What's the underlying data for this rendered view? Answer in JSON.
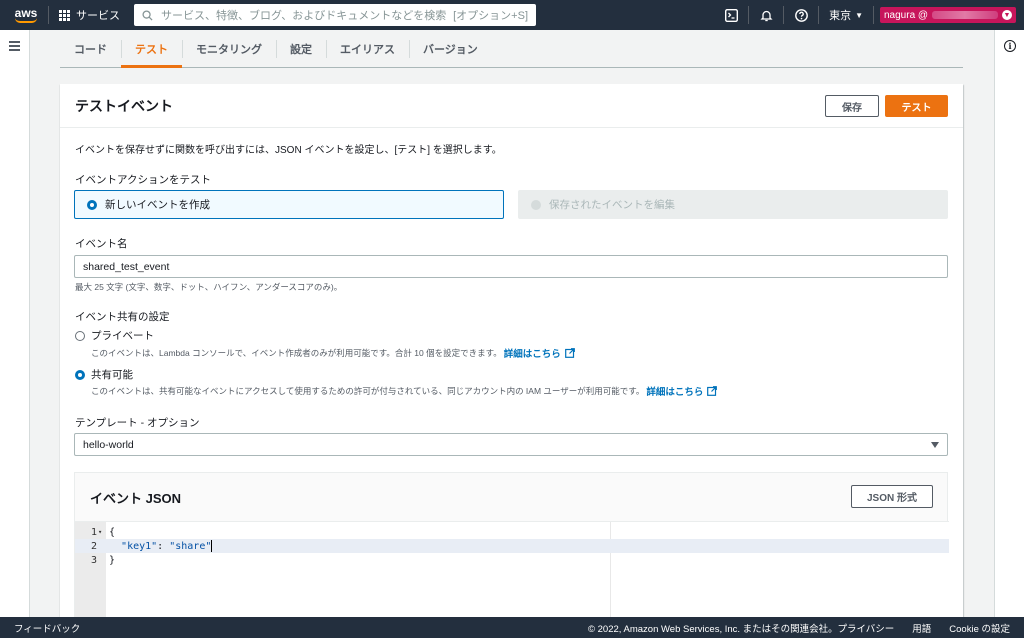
{
  "topnav": {
    "logo_text": "aws",
    "services_label": "サービス",
    "search_placeholder": "サービス、特徴、ブログ、およびドキュメントなどを検索",
    "search_shortcut": "[オプション+S]",
    "region_label": "東京",
    "account_label": "nagura @"
  },
  "tabs": [
    {
      "label": "コード",
      "active": false
    },
    {
      "label": "テスト",
      "active": true
    },
    {
      "label": "モニタリング",
      "active": false
    },
    {
      "label": "設定",
      "active": false
    },
    {
      "label": "エイリアス",
      "active": false
    },
    {
      "label": "バージョン",
      "active": false
    }
  ],
  "panel": {
    "title": "テストイベント",
    "save_label": "保存",
    "test_label": "テスト",
    "description": "イベントを保存せずに関数を呼び出すには、JSON イベントを設定し、[テスト] を選択します。",
    "action_label": "イベントアクションをテスト",
    "action_new": "新しいイベントを作成",
    "action_edit_saved": "保存されたイベントを編集",
    "event_name_label": "イベント名",
    "event_name_value": "shared_test_event",
    "event_name_hint": "最大 25 文字 (文字、数字、ドット、ハイフン、アンダースコアのみ)。",
    "sharing_label": "イベント共有の設定",
    "private_label": "プライベート",
    "private_desc": "このイベントは、Lambda コンソールで、イベント作成者のみが利用可能です。合計 10 個を設定できます。",
    "shareable_label": "共有可能",
    "shareable_desc": "このイベントは、共有可能なイベントにアクセスして使用するための許可が付与されている、同じアカウント内の IAM ユーザーが利用可能です。",
    "learn_more": "詳細はこちら",
    "template_label": "テンプレート - オプション",
    "template_value": "hello-world"
  },
  "json_editor": {
    "title": "イベント JSON",
    "format_button": "JSON 形式",
    "lines": [
      {
        "num": "1",
        "text": "{"
      },
      {
        "num": "2",
        "key": "\"key1\"",
        "sep": ": ",
        "value": "\"share\""
      },
      {
        "num": "3",
        "text": "}"
      }
    ]
  },
  "footer": {
    "feedback": "フィードバック",
    "copyright": "© 2022, Amazon Web Services, Inc. またはその関連会社。",
    "privacy": "プライバシー",
    "terms": "用語",
    "cookie": "Cookie の設定"
  },
  "colors": {
    "nav_bg": "#232f3e",
    "accent": "#ec7211",
    "link": "#0073bb",
    "account_badge": "#c7155b"
  }
}
